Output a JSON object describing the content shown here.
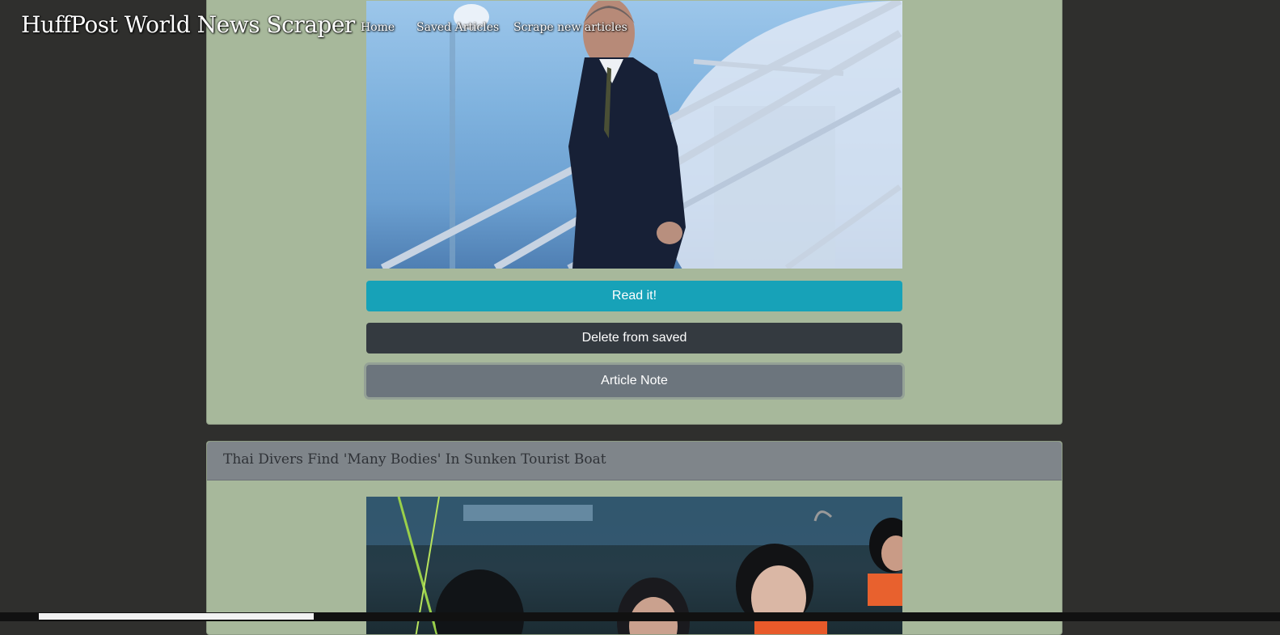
{
  "navbar": {
    "brand": "HuffPost World News Scraper",
    "links": [
      {
        "label": "Home"
      },
      {
        "label": "Saved Articles"
      },
      {
        "label": "Scrape new articles"
      }
    ]
  },
  "articles": [
    {
      "title": "",
      "buttons": {
        "read": "Read it!",
        "delete": "Delete from saved",
        "note": "Article Note"
      }
    },
    {
      "title": "Thai Divers Find 'Many Bodies' In Sunken Tourist Boat"
    }
  ],
  "colors": {
    "page_bg": "#2f2f2d",
    "card_bg": "#a7b89b",
    "card_header_bg": "#7f858a",
    "read_button": "#17a2b8",
    "delete_button": "#343a40",
    "note_button": "#6c757d"
  }
}
